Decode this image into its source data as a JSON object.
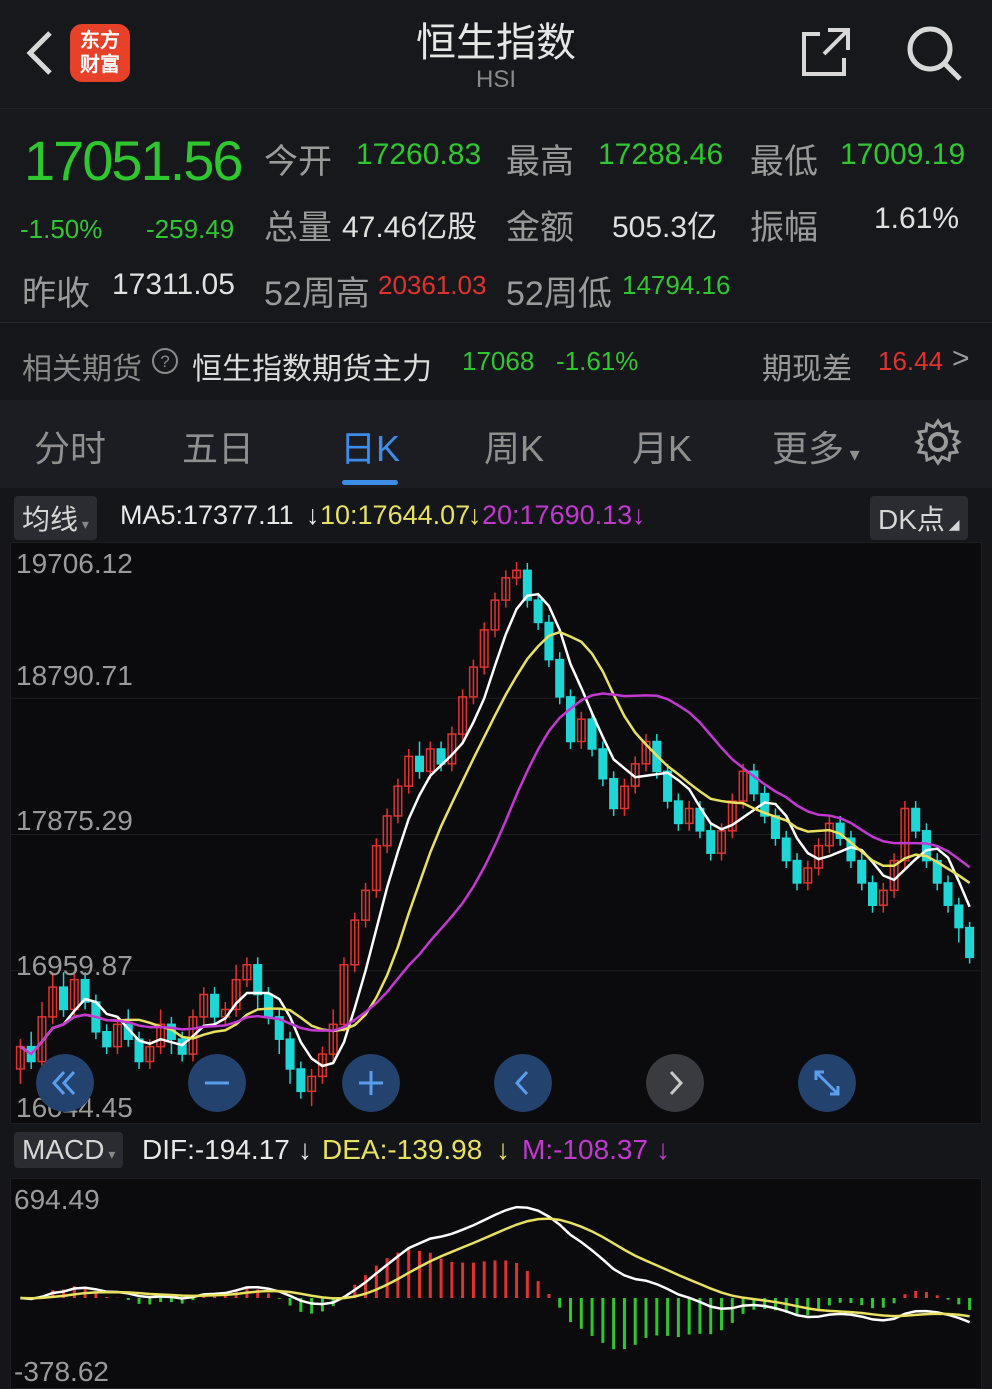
{
  "header": {
    "title": "恒生指数",
    "subtitle": "HSI",
    "logo_line1": "东方",
    "logo_line2": "财富"
  },
  "quote": {
    "price": "17051.56",
    "change_pct": "-1.50%",
    "change_abs": "-259.49",
    "open_label": "今开",
    "open": "17260.83",
    "high_label": "最高",
    "high": "17288.46",
    "low_label": "最低",
    "low": "17009.19",
    "volume_label": "总量",
    "volume": "47.46亿股",
    "amount_label": "金额",
    "amount": "505.3亿",
    "amplitude_label": "振幅",
    "amplitude": "1.61%",
    "prev_close_label": "昨收",
    "prev_close": "17311.05",
    "wk52_high_label": "52周高",
    "wk52_high": "20361.03",
    "wk52_low_label": "52周低",
    "wk52_low": "14794.16"
  },
  "futures": {
    "label": "相关期货",
    "help_icon": "question-circle-icon",
    "name": "恒生指数期货主力",
    "price": "17068",
    "change": "-1.61%",
    "basis_label": "期现差",
    "basis": "16.44",
    "arrow": ">"
  },
  "tabs": [
    "分时",
    "五日",
    "日K",
    "周K",
    "月K",
    "更多"
  ],
  "active_tab": 2,
  "ma": {
    "selector": "均线",
    "ma5": "MA5:17377.11",
    "ma10": "10:17644.07",
    "ma20": "20:17690.13",
    "dk_button": "DK点"
  },
  "kline_axis": [
    "19706.12",
    "18790.71",
    "17875.29",
    "16959.87",
    "16044.45"
  ],
  "macd": {
    "selector": "MACD",
    "dif": "DIF:-194.17",
    "dea": "DEA:-139.98",
    "m": "M:-108.37",
    "axis_top": "694.49",
    "axis_bottom": "-378.62"
  },
  "colors": {
    "up": "#e0332e",
    "down": "#1fd6d6",
    "ma5": "#ffffff",
    "ma10": "#e8e060",
    "ma20": "#c238d0",
    "accent": "#3d8ce8",
    "price_green": "#2fc72f"
  },
  "chart_data": {
    "type": "candlestick",
    "ylim": [
      16044.45,
      19706.12
    ],
    "candles": [
      [
        16300,
        16450,
        16200,
        16500
      ],
      [
        16450,
        16350,
        16300,
        16550
      ],
      [
        16350,
        16650,
        16300,
        16750
      ],
      [
        16650,
        16850,
        16600,
        16950
      ],
      [
        16850,
        16700,
        16650,
        16950
      ],
      [
        16700,
        16900,
        16650,
        16950
      ],
      [
        16900,
        16750,
        16700,
        16950
      ],
      [
        16750,
        16550,
        16500,
        16800
      ],
      [
        16550,
        16450,
        16400,
        16600
      ],
      [
        16450,
        16600,
        16400,
        16650
      ],
      [
        16600,
        16500,
        16450,
        16700
      ],
      [
        16500,
        16350,
        16300,
        16550
      ],
      [
        16350,
        16450,
        16300,
        16500
      ],
      [
        16450,
        16600,
        16400,
        16700
      ],
      [
        16600,
        16500,
        16400,
        16650
      ],
      [
        16500,
        16400,
        16350,
        16550
      ],
      [
        16400,
        16650,
        16350,
        16700
      ],
      [
        16650,
        16800,
        16600,
        16850
      ],
      [
        16800,
        16650,
        16600,
        16850
      ],
      [
        16650,
        16700,
        16600,
        16750
      ],
      [
        16700,
        16900,
        16650,
        17000
      ],
      [
        16900,
        17000,
        16850,
        17050
      ],
      [
        17000,
        16800,
        16700,
        17050
      ],
      [
        16800,
        16650,
        16600,
        16850
      ],
      [
        16650,
        16500,
        16400,
        16700
      ],
      [
        16500,
        16300,
        16200,
        16550
      ],
      [
        16300,
        16150,
        16100,
        16350
      ],
      [
        16150,
        16250,
        16050,
        16300
      ],
      [
        16250,
        16400,
        16200,
        16450
      ],
      [
        16400,
        16600,
        16350,
        16700
      ],
      [
        16600,
        17000,
        16550,
        17050
      ],
      [
        17000,
        17300,
        16950,
        17350
      ],
      [
        17300,
        17500,
        17250,
        17550
      ],
      [
        17500,
        17800,
        17450,
        17850
      ],
      [
        17800,
        18000,
        17750,
        18050
      ],
      [
        18000,
        18200,
        17950,
        18250
      ],
      [
        18200,
        18400,
        18150,
        18450
      ],
      [
        18400,
        18300,
        18250,
        18500
      ],
      [
        18300,
        18450,
        18250,
        18500
      ],
      [
        18450,
        18350,
        18300,
        18500
      ],
      [
        18350,
        18550,
        18300,
        18600
      ],
      [
        18550,
        18800,
        18500,
        18850
      ],
      [
        18800,
        19000,
        18750,
        19050
      ],
      [
        19000,
        19250,
        18950,
        19300
      ],
      [
        19250,
        19450,
        19200,
        19500
      ],
      [
        19450,
        19600,
        19400,
        19650
      ],
      [
        19600,
        19650,
        19550,
        19706
      ],
      [
        19650,
        19450,
        19400,
        19700
      ],
      [
        19450,
        19300,
        19250,
        19500
      ],
      [
        19300,
        19050,
        19000,
        19350
      ],
      [
        19050,
        18800,
        18750,
        19100
      ],
      [
        18800,
        18500,
        18450,
        18850
      ],
      [
        18500,
        18650,
        18450,
        18700
      ],
      [
        18650,
        18450,
        18400,
        18700
      ],
      [
        18450,
        18250,
        18200,
        18500
      ],
      [
        18250,
        18050,
        18000,
        18300
      ],
      [
        18050,
        18200,
        18000,
        18250
      ],
      [
        18200,
        18350,
        18150,
        18400
      ],
      [
        18350,
        18500,
        18300,
        18550
      ],
      [
        18500,
        18300,
        18250,
        18550
      ],
      [
        18300,
        18100,
        18050,
        18350
      ],
      [
        18100,
        17950,
        17900,
        18150
      ],
      [
        17950,
        18050,
        17900,
        18100
      ],
      [
        18050,
        17900,
        17850,
        18100
      ],
      [
        17900,
        17750,
        17700,
        17950
      ],
      [
        17750,
        17900,
        17700,
        17950
      ],
      [
        17900,
        18100,
        17850,
        18150
      ],
      [
        18100,
        18300,
        18050,
        18350
      ],
      [
        18300,
        18150,
        18100,
        18350
      ],
      [
        18150,
        18000,
        17950,
        18200
      ],
      [
        18000,
        17850,
        17800,
        18050
      ],
      [
        17850,
        17700,
        17650,
        17900
      ],
      [
        17700,
        17550,
        17500,
        17750
      ],
      [
        17550,
        17650,
        17500,
        17700
      ],
      [
        17650,
        17800,
        17600,
        17850
      ],
      [
        17800,
        17950,
        17750,
        18000
      ],
      [
        17950,
        17850,
        17800,
        18000
      ],
      [
        17850,
        17700,
        17650,
        17900
      ],
      [
        17700,
        17550,
        17500,
        17750
      ],
      [
        17550,
        17400,
        17350,
        17600
      ],
      [
        17400,
        17500,
        17350,
        17550
      ],
      [
        17500,
        17700,
        17450,
        17750
      ],
      [
        17700,
        18050,
        17650,
        18100
      ],
      [
        18050,
        17900,
        17850,
        18100
      ],
      [
        17900,
        17700,
        17650,
        17950
      ],
      [
        17700,
        17550,
        17500,
        17750
      ],
      [
        17550,
        17400,
        17350,
        17600
      ],
      [
        17400,
        17250,
        17150,
        17450
      ],
      [
        17250,
        17050,
        17009,
        17288
      ]
    ]
  }
}
